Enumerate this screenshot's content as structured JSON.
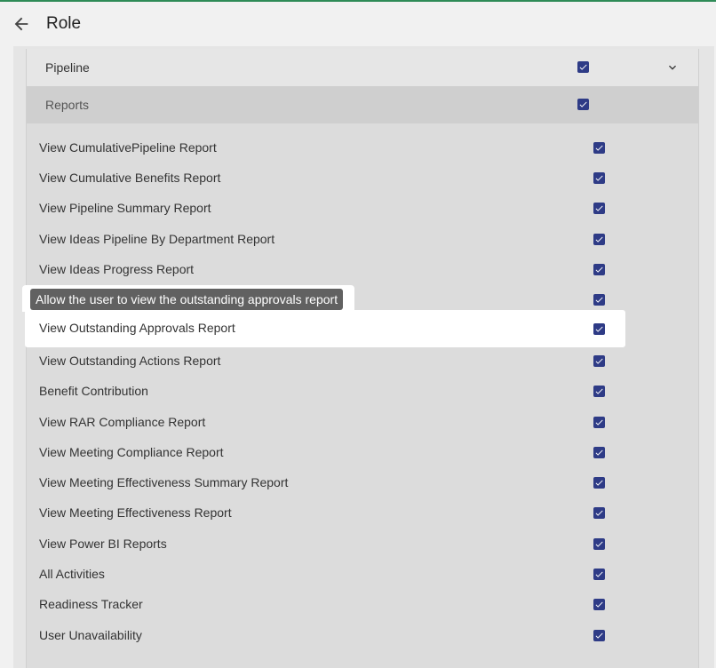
{
  "header": {
    "title": "Role",
    "back_icon": "arrow-left-icon"
  },
  "sections": {
    "pipeline": {
      "label": "Pipeline",
      "checked": true,
      "expand_icon": "chevron-down-icon"
    },
    "reports": {
      "label": "Reports",
      "checked": true
    }
  },
  "tooltip": {
    "text": "Allow the user to view the outstanding approvals report"
  },
  "report_permissions": [
    {
      "label": "View CumulativePipeline Report",
      "checked": true
    },
    {
      "label": "View Cumulative Benefits Report",
      "checked": true
    },
    {
      "label": "View Pipeline Summary Report",
      "checked": true
    },
    {
      "label": "View Ideas Pipeline By Department Report",
      "checked": true
    },
    {
      "label": "View Ideas Progress Report",
      "checked": true
    },
    {
      "label": "",
      "checked": true
    },
    {
      "label": "View Outstanding Approvals Report",
      "checked": true,
      "highlighted": true
    },
    {
      "label": "View Outstanding Actions Report",
      "checked": true
    },
    {
      "label": "Benefit Contribution",
      "checked": true
    },
    {
      "label": "View RAR Compliance Report",
      "checked": true
    },
    {
      "label": "View Meeting Compliance Report",
      "checked": true
    },
    {
      "label": "View Meeting Effectiveness Summary Report",
      "checked": true
    },
    {
      "label": "View Meeting Effectiveness Report",
      "checked": true
    },
    {
      "label": "View Power BI Reports",
      "checked": true
    },
    {
      "label": "All Activities",
      "checked": true
    },
    {
      "label": "Readiness Tracker",
      "checked": true
    },
    {
      "label": "User Unavailability",
      "checked": true
    }
  ],
  "colors": {
    "checkbox": "#2e3b86",
    "accent_line": "#2e8b57",
    "tooltip_bg": "#616161"
  }
}
